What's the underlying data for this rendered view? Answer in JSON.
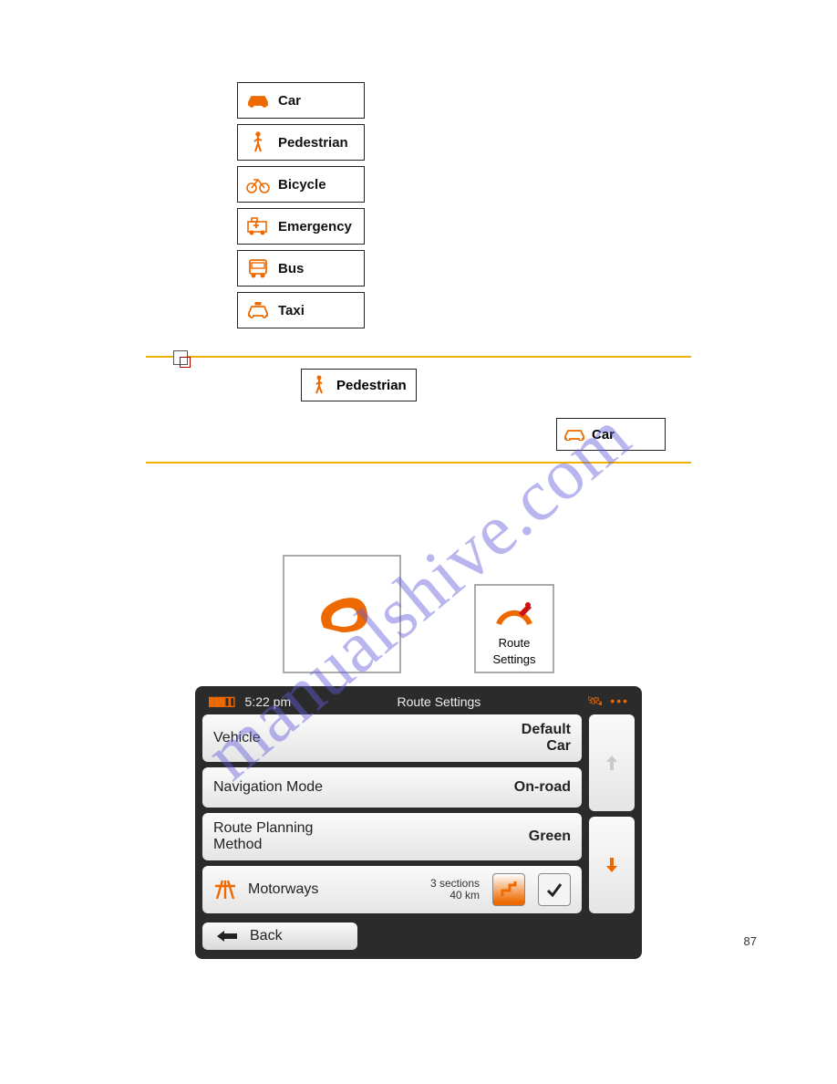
{
  "watermark": "manualshive.com",
  "vehicle_list": {
    "items": [
      {
        "icon": "car-icon",
        "label": "Car"
      },
      {
        "icon": "pedestrian-icon",
        "label": "Pedestrian"
      },
      {
        "icon": "bicycle-icon",
        "label": "Bicycle"
      },
      {
        "icon": "emergency-icon",
        "label": "Emergency"
      },
      {
        "icon": "bus-icon",
        "label": "Bus"
      },
      {
        "icon": "taxi-icon",
        "label": "Taxi"
      }
    ]
  },
  "note": {
    "inline_ped": "Pedestrian",
    "inline_car": "Car"
  },
  "route_settings_tile": {
    "line1": "Route",
    "line2": "Settings"
  },
  "device": {
    "time": "5:22 pm",
    "title": "Route Settings",
    "rows": {
      "vehicle": {
        "label": "Vehicle",
        "value_line1": "Default",
        "value_line2": "Car"
      },
      "nav_mode": {
        "label": "Navigation Mode",
        "value": "On-road"
      },
      "method": {
        "label_line1": "Route Planning",
        "label_line2": "Method",
        "value": "Green"
      },
      "motorways": {
        "label": "Motorways",
        "info_line1": "3 sections",
        "info_line2": "40 km"
      }
    },
    "back": "Back"
  },
  "page_number": "87"
}
